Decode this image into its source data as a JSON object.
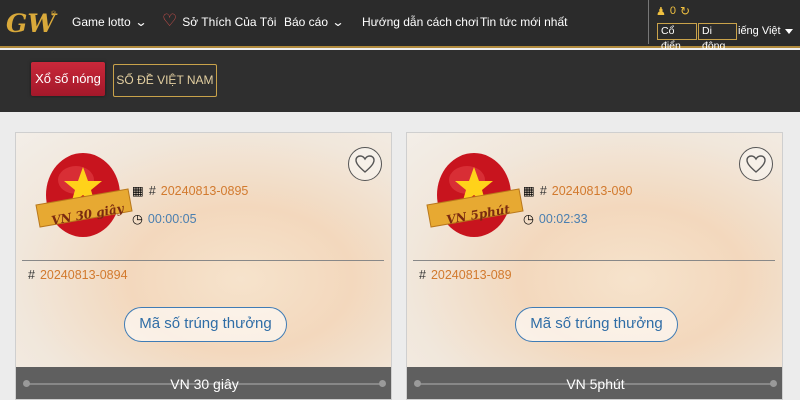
{
  "nav": {
    "logo_text": "GW",
    "items": [
      {
        "label": "Game lotto",
        "has_dropdown": true
      },
      {
        "label": "Sở Thích Của Tôi",
        "icon": "heart-icon"
      },
      {
        "label": "Báo cáo",
        "has_dropdown": true
      },
      {
        "label": "Hướng dẫn cách chơi"
      },
      {
        "label": "Tin tức mới nhất"
      }
    ],
    "balance": "0",
    "mode_classic": "Cổ điển",
    "mode_mobile": "Di động",
    "language": "iếng Việt"
  },
  "tabs": {
    "hot": "Xổ số nóng",
    "vietnam": "SỐ ĐỀ VIỆT NAM"
  },
  "colors": {
    "accent_gold": "#c9a24a",
    "tab_active": "#c9283a",
    "issue_orange": "#d27a2e",
    "timer_blue": "#4a7fb0"
  },
  "cards": [
    {
      "badge_text": "VN 30 giây",
      "current_issue": "20240813-0895",
      "countdown": "00:00:05",
      "previous_issue": "20240813-0894",
      "button": "Mã số trúng thưởng",
      "footer": "VN 30 giây"
    },
    {
      "badge_text": "VN 5phút",
      "current_issue": "20240813-090",
      "countdown": "00:02:33",
      "previous_issue": "20240813-089",
      "button": "Mã số trúng thưởng",
      "footer": "VN 5phút"
    }
  ],
  "hash_symbol": "#"
}
